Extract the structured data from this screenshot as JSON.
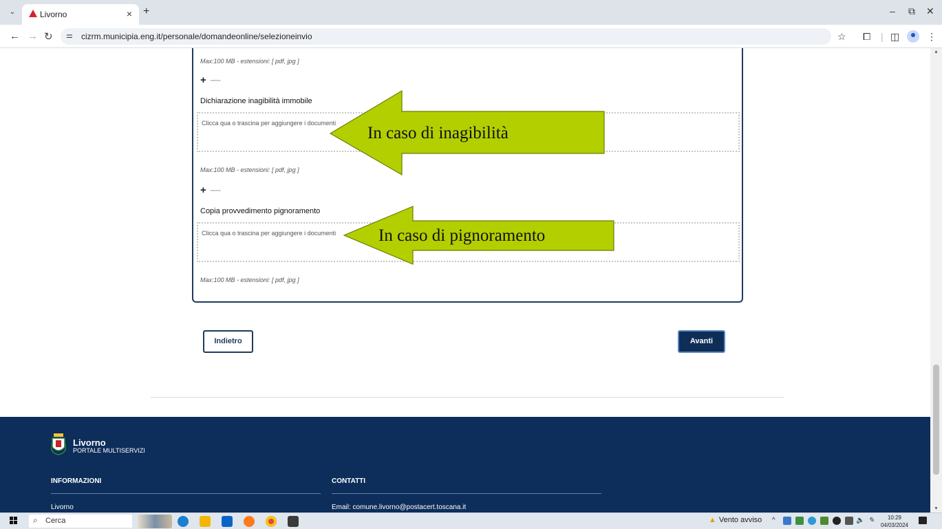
{
  "browser": {
    "tab_title": "Livorno",
    "tab_close": "×",
    "new_tab": "+",
    "url": "cizrm.municipia.eng.it/personale/domandeonline/selezioneinvio"
  },
  "form": {
    "hint_top": "Max:100 MB - estensioni: [ pdf, jpg ]",
    "plus": "+",
    "minus": "—",
    "doc1_label": "Dichiarazione inagibilità immobile",
    "dropzone1": "Clicca qua o trascina per aggiungere i documenti",
    "hint1": "Max:100 MB - estensioni: [ pdf, jpg ]",
    "doc2_label": "Copia provvedimento pignoramento",
    "dropzone2": "Clicca qua o trascina per aggiungere i documenti",
    "hint2": "Max:100 MB - estensioni: [ pdf, jpg ]"
  },
  "annotations": {
    "arrow1": "In caso di inagibilità",
    "arrow2": "In caso di pignoramento",
    "arrow_color": "#b3cf00"
  },
  "buttons": {
    "back": "Indietro",
    "next": "Avanti"
  },
  "footer": {
    "brand_name": "Livorno",
    "brand_sub": "PORTALE MULTISERVIZI",
    "col1_heading": "INFORMAZIONI",
    "col1_text": "Livorno",
    "col2_heading": "CONTATTI",
    "col2_text": "Email: comune.livorno@postacert.toscana.it"
  },
  "taskbar": {
    "search_placeholder": "Cerca",
    "weather": "Vento avviso",
    "time": "10:29",
    "date": "04/03/2024"
  },
  "colors": {
    "navy": "#0d2d5a",
    "accent_blue": "#0e2d57"
  }
}
